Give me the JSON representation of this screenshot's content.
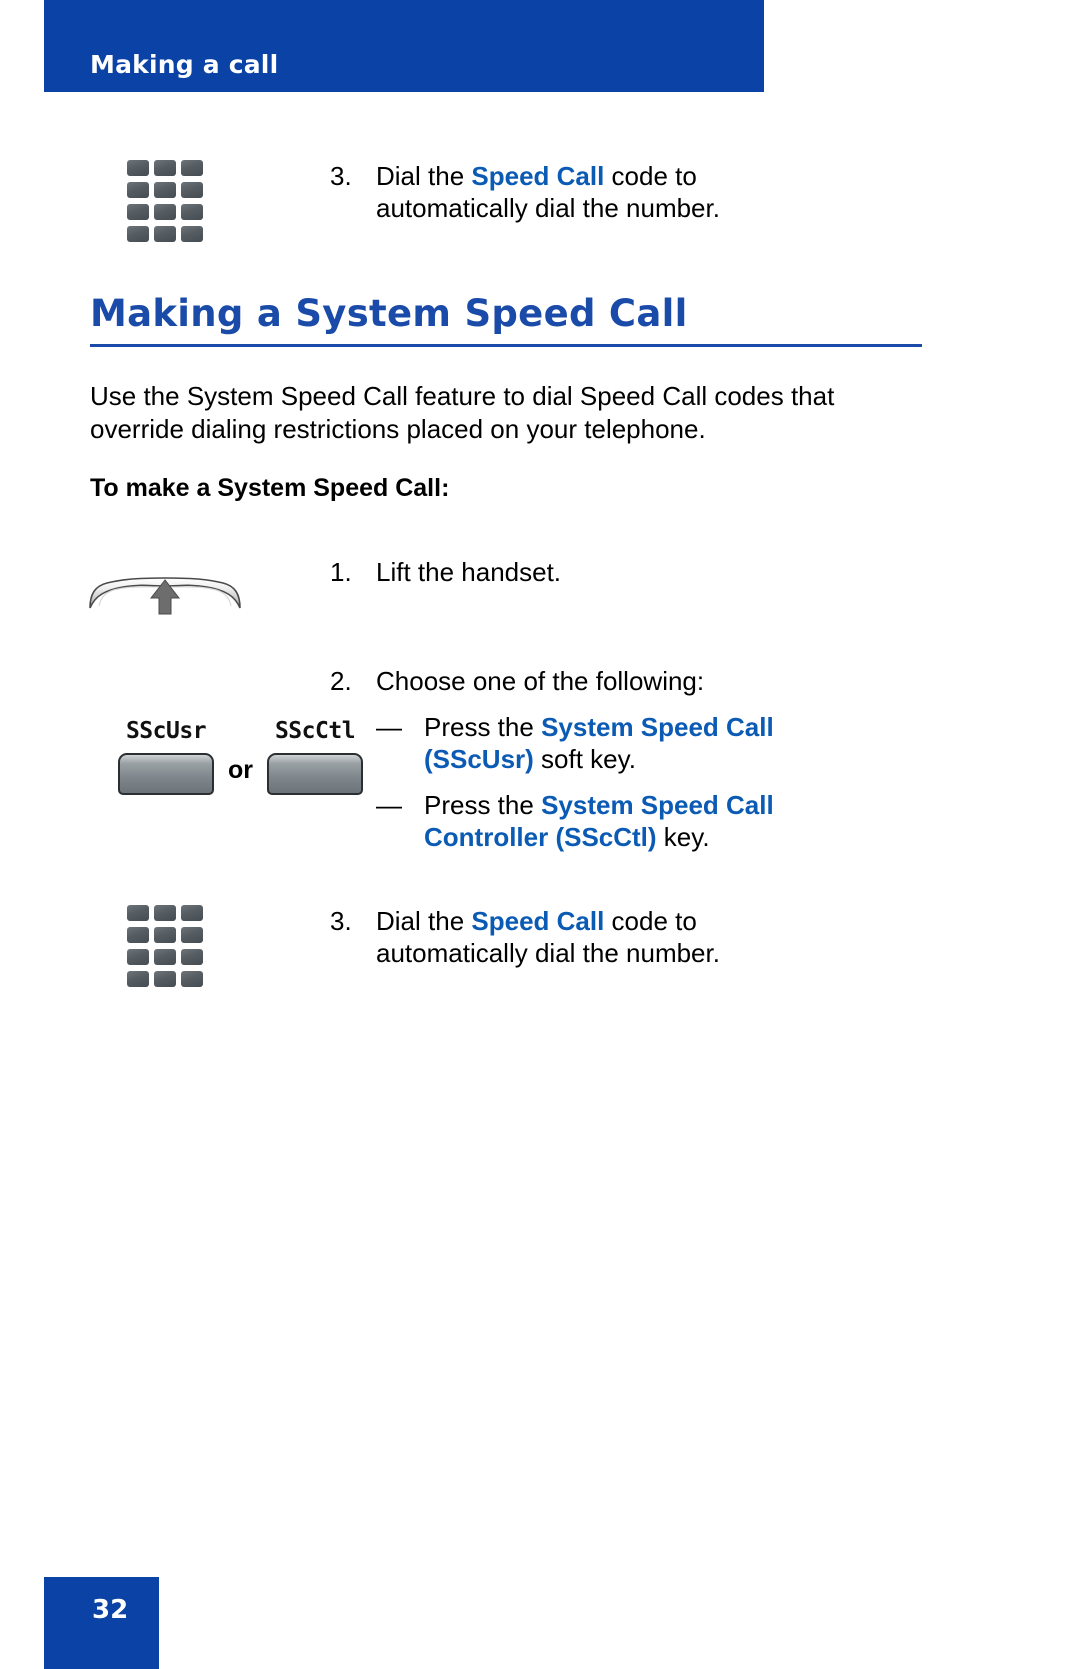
{
  "header": {
    "title": "Making a call",
    "bg_color": "#0a43a5",
    "text_color": "#ffffff"
  },
  "top_step": {
    "number": "3.",
    "text_before": "Dial the ",
    "highlight": "Speed Call",
    "text_after": " code to automatically dial the number.",
    "icon": "keypad-icon"
  },
  "section": {
    "heading": "Making a System Speed Call",
    "heading_color": "#1b4ba8",
    "paragraph": "Use the System Speed Call feature to dial Speed Call codes that override dialing restrictions placed on your telephone.",
    "subheading": "To make a System Speed Call:"
  },
  "steps": [
    {
      "number": "1.",
      "text": "Lift the handset.",
      "icon": "handset-icon"
    },
    {
      "number": "2.",
      "text": "Choose one of the following:",
      "icon": "softkeys-icon",
      "bullets": [
        {
          "dash": "—",
          "before": "Press the ",
          "highlight": "System Speed Call (SScUsr)",
          "after": " soft key."
        },
        {
          "dash": "—",
          "before": "Press the ",
          "highlight": "System Speed Call Controller (SScCtl)",
          "after": " key."
        }
      ]
    },
    {
      "number": "3.",
      "text_before": "Dial the ",
      "highlight": "Speed Call",
      "text_after": " code to automatically dial the number.",
      "icon": "keypad-icon"
    }
  ],
  "softkeys": {
    "left_label": "SScUsr",
    "separator": "or",
    "right_label": "SScCtl"
  },
  "footer": {
    "page_number": "32",
    "bg_color": "#0a43a5"
  },
  "colors": {
    "brand_blue": "#0a43a5",
    "heading_blue": "#1b4ba8",
    "link_blue": "#0b5bb5"
  }
}
